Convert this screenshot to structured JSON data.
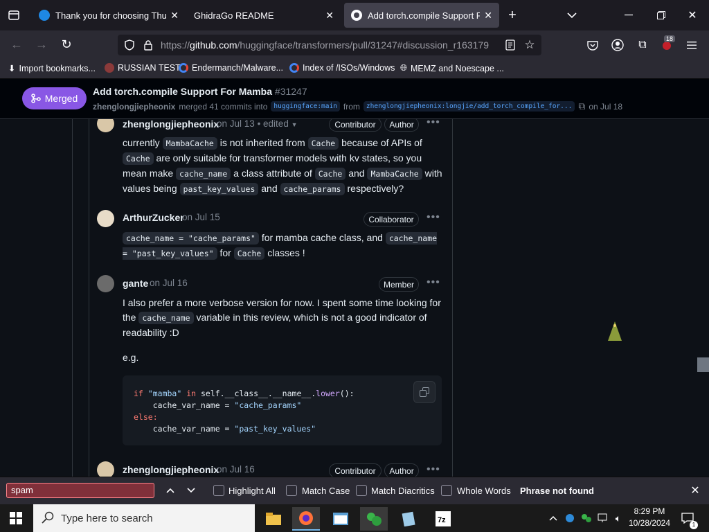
{
  "browser": {
    "tabs": [
      {
        "title": "Thank you for choosing Thunde"
      },
      {
        "title": "GhidraGo README"
      },
      {
        "title": "Add torch.compile Support For"
      }
    ],
    "url_prefix": "https://",
    "url_domain": "github.com",
    "url_path": "/huggingface/transformers/pull/31247#discussion_r163179",
    "extensions_badge": "18",
    "bookmarks": [
      {
        "label": "Import bookmarks..."
      },
      {
        "label": "RUSSIAN TEST"
      },
      {
        "label": "Endermanch/Malware..."
      },
      {
        "label": "Index of /ISOs/Windows"
      },
      {
        "label": "MEMZ and Noescape ..."
      }
    ]
  },
  "pr": {
    "state": "Merged",
    "title": "Add torch.compile Support For Mamba",
    "number": "#31247",
    "user": "zhenglongjiepheonix",
    "merged_text": "merged 41 commits into",
    "base_branch": "huggingface:main",
    "from": "from",
    "head_branch": "zhenglongjiepheonix:longjie/add_torch_compile_for...",
    "date": "on Jul 18"
  },
  "comments": [
    {
      "author": "zhenglongjiepheonix",
      "date": "on Jul 13",
      "edited": "• edited",
      "badges": [
        "Contributor",
        "Author"
      ]
    },
    {
      "author": "ArthurZucker",
      "date": "on Jul 15",
      "badges": [
        "Collaborator"
      ]
    },
    {
      "author": "gante",
      "date": "on Jul 16",
      "badges": [
        "Member"
      ]
    },
    {
      "author": "zhenglongjiepheonix",
      "date": "on Jul 16",
      "badges": [
        "Contributor",
        "Author"
      ]
    }
  ],
  "c1": {
    "t1": "currently ",
    "code1": "MambaCache",
    "t2": " is not inherited from ",
    "code2": "Cache",
    "t3": " because of APIs of ",
    "code3": "Cache",
    "t4": " are only suitable for transformer models with kv states, so you mean make ",
    "code4": "cache_name",
    "t5": " a class attribute of ",
    "code5": "Cache",
    "t6": " and ",
    "code6": "MambaCache",
    "t7": " with values being ",
    "code7": "past_key_values",
    "t8": " and ",
    "code8": "cache_params",
    "t9": " respectively?"
  },
  "c2": {
    "code1": "cache_name = \"cache_params\"",
    "t1": " for mamba cache class, and ",
    "code2": "cache_name = \"past_key_values\"",
    "t2": " for ",
    "code3": "Cache",
    "t3": " classes !"
  },
  "c3": {
    "t1": "I also prefer a more verbose version for now. I spent some time looking for the ",
    "code1": "cache_name",
    "t2": " variable in this review, which is not a good indicator of readability :D",
    "eg": "e.g.",
    "l1_kw": "if",
    "l1_str": "\"mamba\"",
    "l1_in": "in",
    "l1_rest": " self.__class__.__name__.",
    "l1_fn": "lower",
    "l1_end": "():",
    "l2_a": "    cache_var_name = ",
    "l2_str": "\"cache_params\"",
    "l3_kw": "else:",
    "l4_a": "    cache_var_name = ",
    "l4_str": "\"past_key_values\""
  },
  "findbar": {
    "query": "spam",
    "highlight_all": "Highlight All",
    "match_case": "Match Case",
    "match_diacritics": "Match Diacritics",
    "whole_words": "Whole Words",
    "status": "Phrase not found"
  },
  "taskbar": {
    "search_placeholder": "Type here to search",
    "time": "8:29 PM",
    "date": "10/28/2024"
  },
  "colors": {
    "merged": "#8957e5",
    "link": "#58a6ff",
    "find_error": "#80303a"
  }
}
